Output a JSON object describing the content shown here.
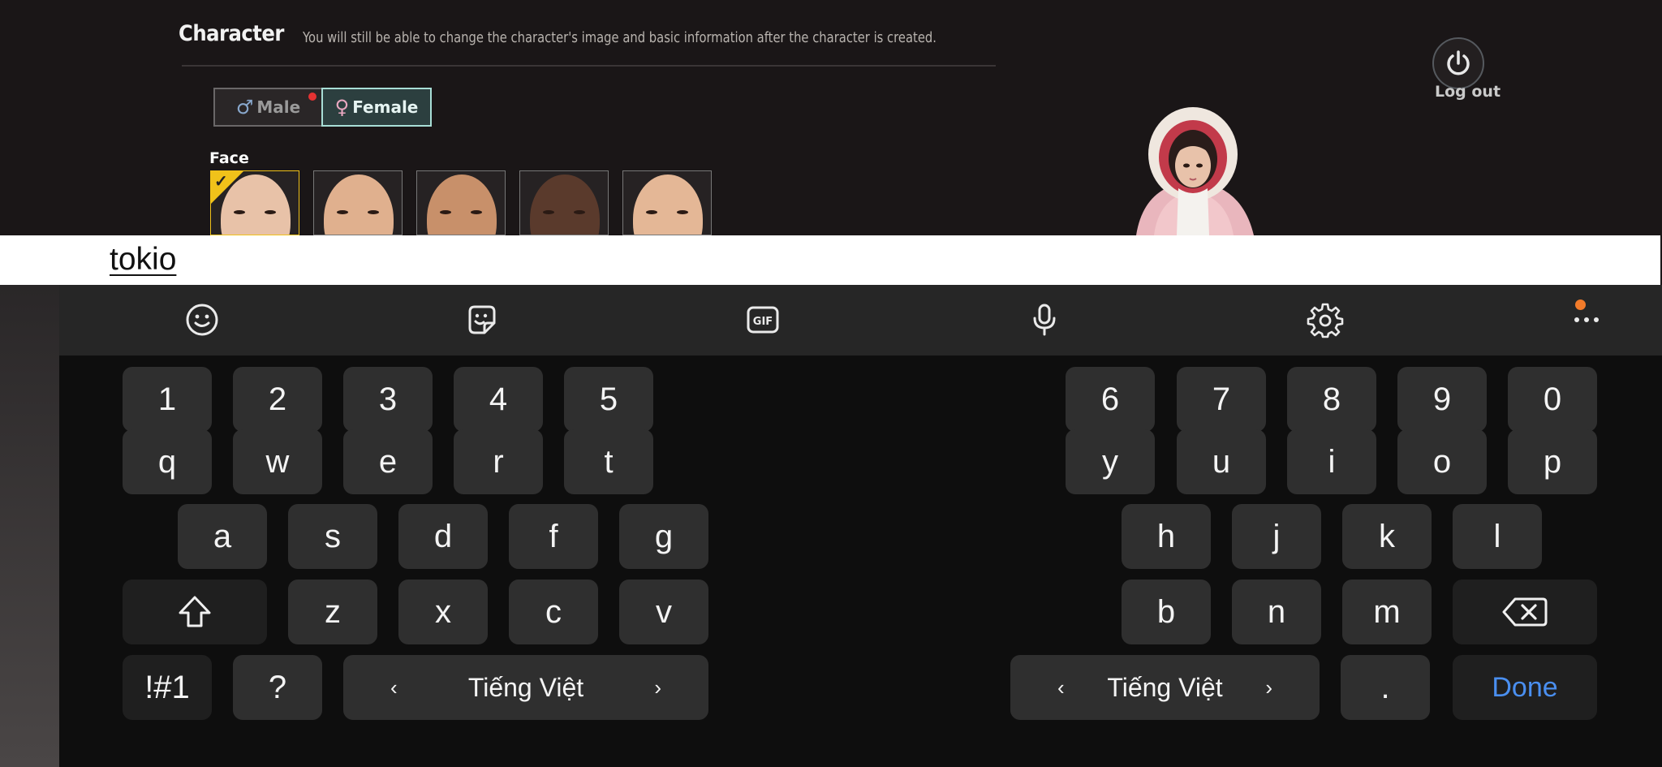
{
  "game": {
    "title": "Character",
    "subtitle": "You will still be able to change the character's image and basic information after the character is created.",
    "gender": {
      "male_label": "Male",
      "female_label": "Female",
      "male_symbol": "♂",
      "female_symbol": "♀",
      "selected": "Female"
    },
    "face_label": "Face",
    "faces": [
      {
        "skin": "#e8c2a8",
        "selected": true
      },
      {
        "skin": "#e0b08e",
        "selected": false
      },
      {
        "skin": "#c8906a",
        "selected": false
      },
      {
        "skin": "#5a3a2c",
        "selected": false
      },
      {
        "skin": "#e4b796",
        "selected": false
      }
    ],
    "logout_label": "Log out"
  },
  "input": {
    "value": "tokio"
  },
  "keyboard": {
    "toolbar": [
      "emoji-icon",
      "sticker-icon",
      "gif-icon",
      "microphone-icon",
      "settings-icon",
      "more-icon"
    ],
    "gif_text": "GIF",
    "numbers_left": [
      "1",
      "2",
      "3",
      "4",
      "5"
    ],
    "numbers_right": [
      "6",
      "7",
      "8",
      "9",
      "0"
    ],
    "row1_left": [
      "q",
      "w",
      "e",
      "r",
      "t"
    ],
    "row1_right": [
      "y",
      "u",
      "i",
      "o",
      "p"
    ],
    "row2_left": [
      "a",
      "s",
      "d",
      "f",
      "g"
    ],
    "row2_right": [
      "h",
      "j",
      "k",
      "l"
    ],
    "row3_left": [
      "z",
      "x",
      "c",
      "v"
    ],
    "row3_right": [
      "b",
      "n",
      "m"
    ],
    "symbols_label": "!#1",
    "question_label": "?",
    "language_label": "Tiếng Việt",
    "arrow_left": "‹",
    "arrow_right": "›",
    "period_label": ".",
    "done_label": "Done",
    "accent_color": "#4a8ff0"
  }
}
